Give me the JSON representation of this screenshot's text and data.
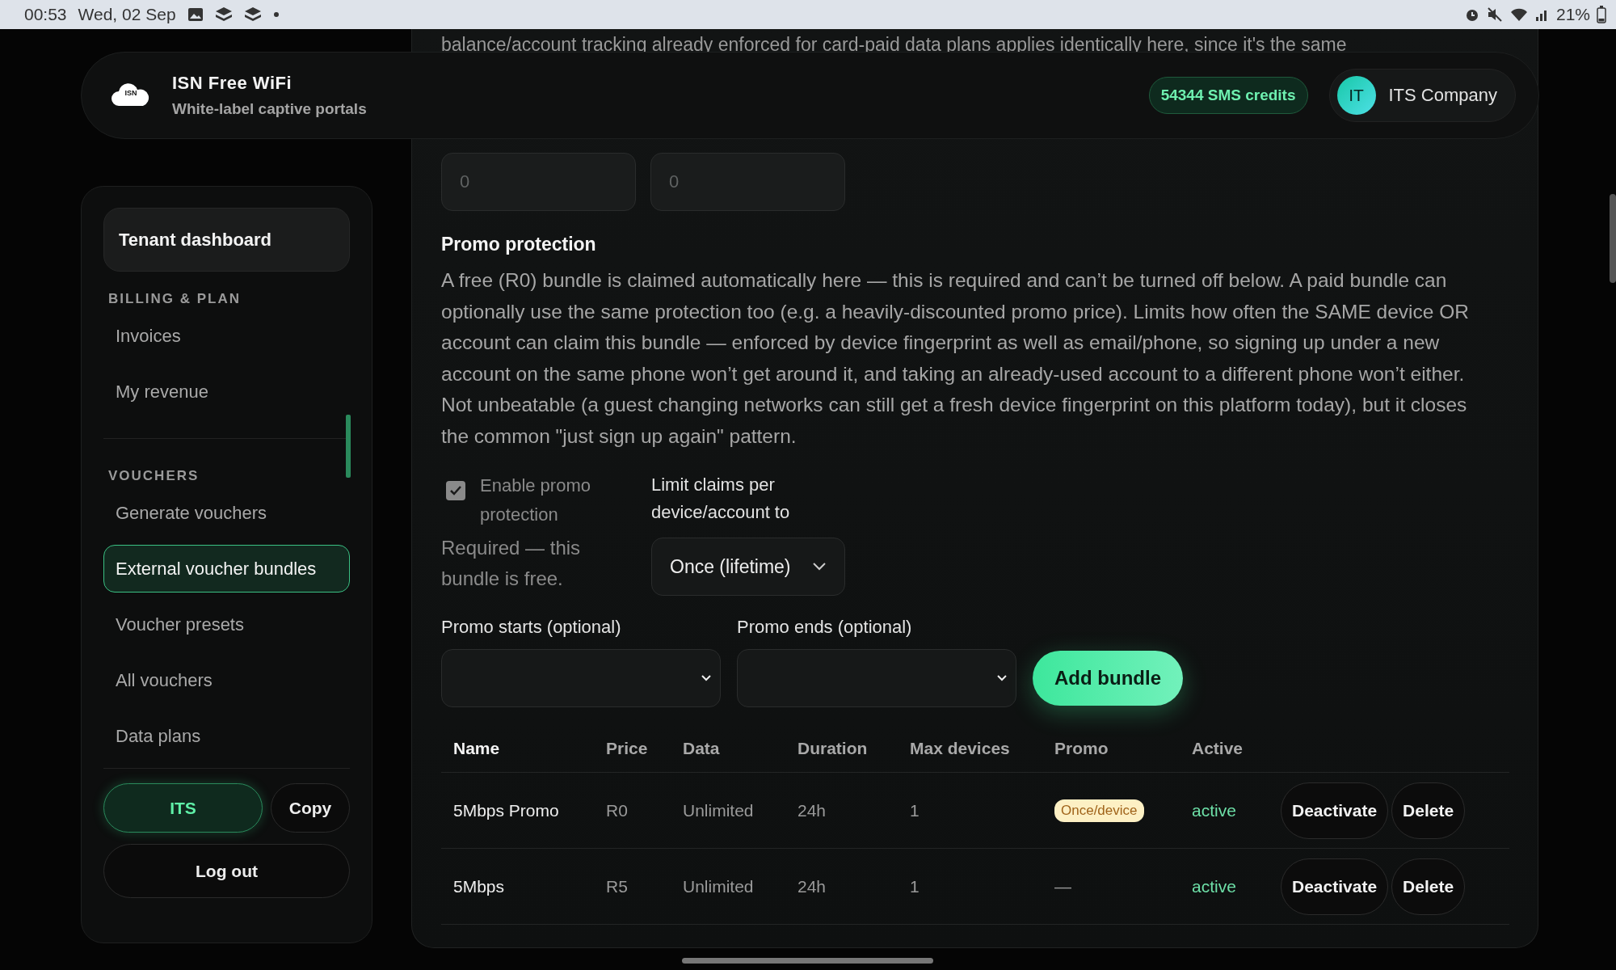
{
  "status_bar": {
    "time": "00:53",
    "date": "Wed, 02 Sep",
    "battery": "21%"
  },
  "header": {
    "logo_text": "ISN",
    "title": "ISN Free WiFi",
    "subtitle": "White-label captive portals",
    "credits": "54344 SMS credits",
    "avatar": "IT",
    "account": "ITS Company"
  },
  "sidebar": {
    "title": "Tenant dashboard",
    "sections": [
      {
        "label": "BILLING & PLAN",
        "items": [
          {
            "label": "Invoices",
            "selected": false
          },
          {
            "label": "My revenue",
            "selected": false
          }
        ]
      },
      {
        "label": "VOUCHERS",
        "items": [
          {
            "label": "Generate vouchers",
            "selected": false
          },
          {
            "label": "External voucher bundles",
            "selected": true
          },
          {
            "label": "Voucher presets",
            "selected": false
          },
          {
            "label": "All vouchers",
            "selected": false
          },
          {
            "label": "Data plans",
            "selected": false
          }
        ]
      }
    ],
    "tenant_code": "ITS",
    "copy_button": "Copy",
    "logout_button": "Log out"
  },
  "content": {
    "cut_text": "balance/account tracking already enforced for card-paid data plans applies identically here, since it's the same",
    "limit_fields": [
      {
        "placeholder": "0"
      },
      {
        "placeholder": "0"
      }
    ],
    "promo": {
      "heading": "Promo protection",
      "description": "A free (R0) bundle is claimed automatically here — this is required and can’t be turned off below. A paid bundle can optionally use the same protection too (e.g. a heavily-discounted promo price). Limits how often the SAME device OR account can claim this bundle — enforced by device fingerprint as well as email/phone, so signing up under a new account on the same phone won’t get around it, and taking an already-used account to a different phone won’t either. Not unbeatable (a guest changing networks can still get a fresh device fingerprint on this platform today), but it closes the common \"just sign up again\" pattern.",
      "enable": {
        "label": "Enable promo protection",
        "checked": true,
        "disabled": true
      },
      "required_note": "Required — this bundle is free.",
      "limit_label": "Limit claims per device/account to",
      "limit_value": "Once (lifetime)",
      "starts_label": "Promo starts (optional)",
      "ends_label": "Promo ends (optional)",
      "add_button": "Add bundle"
    },
    "table": {
      "columns": [
        "Name",
        "Price",
        "Data",
        "Duration",
        "Max devices",
        "Promo",
        "Active"
      ],
      "rows": [
        {
          "name": "5Mbps Promo",
          "price": "R0",
          "data": "Unlimited",
          "duration": "24h",
          "max_devices": "1",
          "promo": {
            "kind": "badge",
            "text": "Once/device"
          },
          "active": "active",
          "actions": [
            "Deactivate",
            "Delete"
          ]
        },
        {
          "name": "5Mbps",
          "price": "R5",
          "data": "Unlimited",
          "duration": "24h",
          "max_devices": "1",
          "promo": {
            "kind": "text",
            "text": "—"
          },
          "active": "active",
          "actions": [
            "Deactivate",
            "Delete"
          ]
        }
      ]
    }
  }
}
